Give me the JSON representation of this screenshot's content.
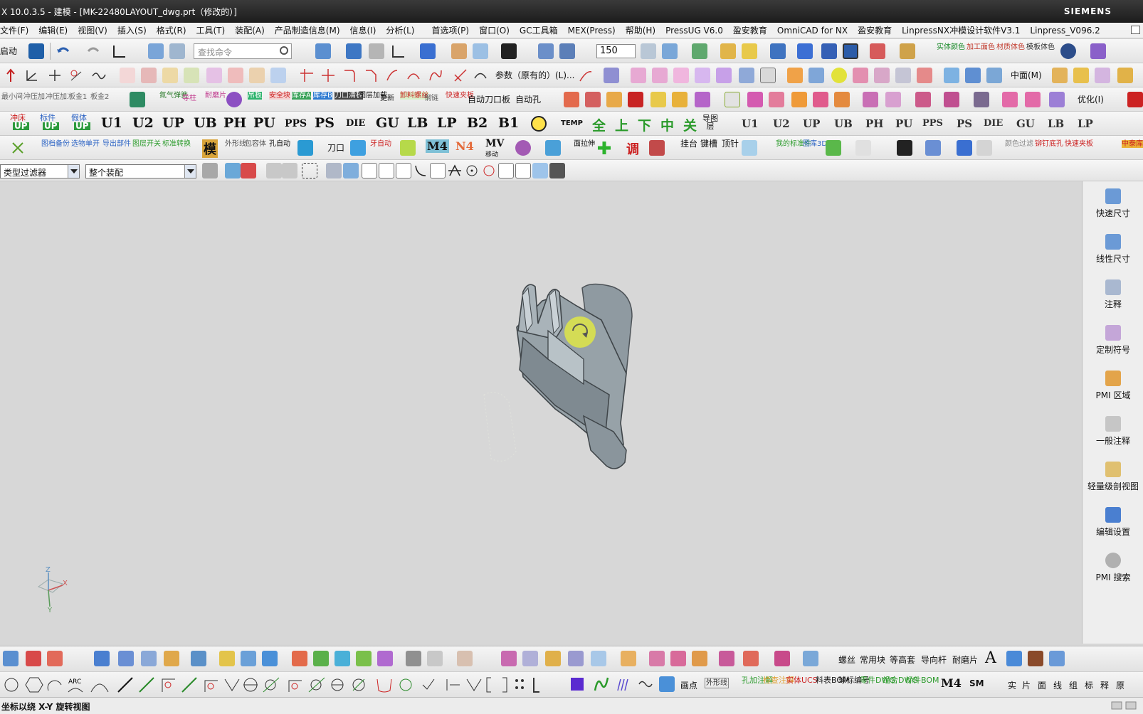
{
  "window": {
    "title": "X 10.0.3.5 - 建模 - [MK-22480LAYOUT_dwg.prt（修改的）]",
    "brand": "SIEMENS"
  },
  "menu": [
    "文件(F)",
    "编辑(E)",
    "视图(V)",
    "插入(S)",
    "格式(R)",
    "工具(T)",
    "装配(A)",
    "产品制造信息(M)",
    "信息(I)",
    "分析(L)",
    "首选项(P)",
    "窗口(O)",
    "GC工具箱",
    "MEX(Press)",
    "帮助(H)",
    "PressUG V6.0",
    "盈安教育",
    "OmniCAD for NX",
    "盈安教育",
    "LinpressNX冲模设计软件V3.1",
    "Linpress_V096.2"
  ],
  "toolbar1": {
    "start_label": "启动",
    "search_placeholder": "查找命令",
    "zoom_value": "150",
    "cap_shiti": "实体颜色",
    "cap_jiagong": "加工面色",
    "cap_cailiao": "材质体色",
    "cap_muban": "模板体色"
  },
  "toolbar2": {
    "param_label": "参数（原有的）(L)...",
    "zhongmian_label": "中面(M)"
  },
  "toolbar3": {
    "tags": [
      "最小间件",
      "冲压加工",
      "冲压加工",
      "板金1",
      "板金2"
    ],
    "caps": [
      "氮气弹簧",
      "导柱",
      "耐磨片",
      "吊板",
      "安全块",
      "库存A",
      "库存B",
      "刀口清板",
      "图层加载",
      "更新",
      "卸料螺丝",
      "钢链",
      "快速夹板"
    ],
    "auto_knife": "自动刀口板",
    "auto_hole": "自动孔",
    "optimize": "优化(I)"
  },
  "toolbar4": {
    "pairs": [
      {
        "top": "冲床",
        "bottom": "UP"
      },
      {
        "top": "标件",
        "bottom": "UP"
      },
      {
        "top": "假体",
        "bottom": "UP"
      }
    ],
    "big": [
      "U1",
      "U2",
      "UP",
      "UB",
      "PH",
      "PU",
      "PPS",
      "PS",
      "DIE",
      "GU",
      "LB",
      "LP",
      "B2",
      "B1"
    ],
    "temp": "TEMP",
    "chinese": [
      "全",
      "上",
      "下",
      "中",
      "关"
    ],
    "layer_label": "导图层",
    "small": [
      "U1",
      "U2",
      "UP",
      "UB",
      "PH",
      "PU",
      "PPS",
      "PS",
      "DIE",
      "GU",
      "LB",
      "LP"
    ],
    "small_sub": "移"
  },
  "toolbar5": {
    "caps": [
      "图档备份",
      "选物单开",
      "导出部件",
      "图层开关",
      "标准转换"
    ],
    "mo": "模",
    "caps2": [
      "外形线",
      "包容体",
      "孔自动"
    ],
    "knife": "刀口",
    "ya_auto": "牙自动",
    "m4": "M4",
    "n4": "N4",
    "mv": "MV",
    "mv_sub": "移动",
    "mian_lashen": "面拉伸",
    "diao": "调",
    "gua_tai": "挂台",
    "jian_cao": "键槽",
    "ding_zhen": "顶针",
    "wode": "我的标准件",
    "tuku": "图库3D",
    "yanse": "颜色过滤",
    "mao_ding": "铆钉底孔",
    "kuaisu": "快速夹板",
    "zhonghua": "中泰库存"
  },
  "selection_bar": {
    "filter": "类型过滤器",
    "scope": "整个装配"
  },
  "pmi_panel": [
    {
      "label": "快速尺寸",
      "icon": "quick-dimension-icon"
    },
    {
      "label": "线性尺寸",
      "icon": "linear-dimension-icon"
    },
    {
      "label": "注释",
      "icon": "note-icon"
    },
    {
      "label": "定制符号",
      "icon": "custom-symbol-icon"
    },
    {
      "label": "PMI 区域",
      "icon": "pmi-region-icon"
    },
    {
      "label": "一般注释",
      "icon": "general-note-icon"
    },
    {
      "label": "轻量级剖视图",
      "icon": "lightweight-section-icon"
    },
    {
      "label": "编辑设置",
      "icon": "edit-settings-icon"
    },
    {
      "label": "PMI 搜索",
      "icon": "pmi-search-icon"
    }
  ],
  "triad": {
    "x": "X",
    "y": "Y",
    "z": "Z"
  },
  "bottom1": {
    "labels": [
      "螺丝",
      "常用块",
      "等高套",
      "导向杆",
      "耐磨片"
    ],
    "big_a": "A"
  },
  "bottom2": {
    "arc": "ARC",
    "huadian": "画点",
    "waixing": "外形线",
    "caps": [
      "孔加注解",
      "检查注解",
      "实体UCS",
      "料表BOM",
      "球标编号",
      "零件DWG",
      "组合DWG",
      "标件BOM"
    ],
    "m4": "M4",
    "sm": "SM",
    "tail": [
      "实",
      "片",
      "面",
      "线",
      "组",
      "标",
      "释",
      "原"
    ]
  },
  "status": "坐标以绕 X-Y 旋转视图"
}
